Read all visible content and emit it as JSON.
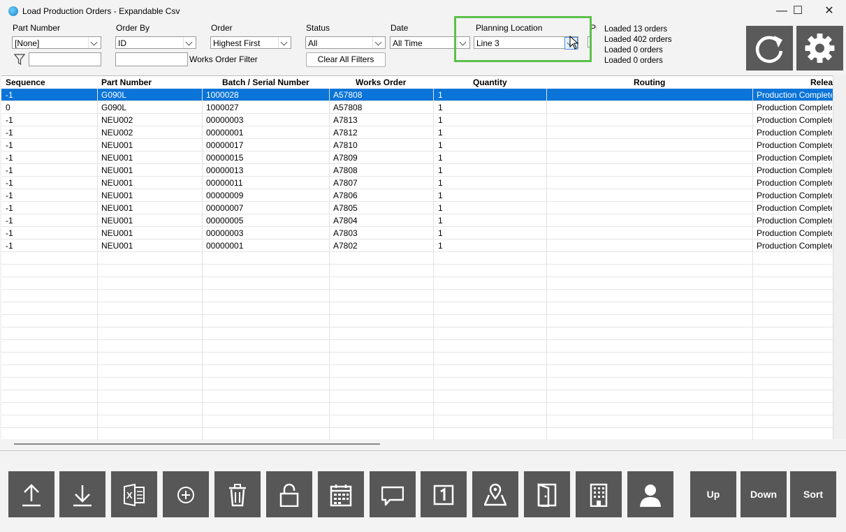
{
  "window": {
    "title": "Load Production Orders - Expandable Csv",
    "minimize": "—",
    "maximize": "☐",
    "close": "✕"
  },
  "filters": {
    "part_number": {
      "label": "Part Number",
      "value": "[None]"
    },
    "order_by": {
      "label": "Order By",
      "value": "ID"
    },
    "order": {
      "label": "Order",
      "value": "Highest First"
    },
    "status": {
      "label": "Status",
      "value": "All"
    },
    "date": {
      "label": "Date",
      "value": "All Time"
    },
    "planning_location": {
      "label": "Planning Location",
      "value": "Line 3"
    },
    "clipped_label": "Pr",
    "works_order_filter_label": "Works Order Filter",
    "clear_all_filters": "Clear All Filters"
  },
  "status_lines": [
    "Loaded 13 orders",
    "Loaded 402 orders",
    "Loaded 0 orders",
    "Loaded 0 orders"
  ],
  "grid": {
    "columns": [
      "Sequence",
      "Part Number",
      "Batch / Serial Number",
      "Works Order",
      "Quantity",
      "Routing",
      "Releas"
    ],
    "rows": [
      [
        "-1",
        "G090L",
        "1000028",
        "A57808",
        "1",
        "",
        "Production Complete"
      ],
      [
        "0",
        "G090L",
        "1000027",
        "A57808",
        "1",
        "",
        "Production Complete"
      ],
      [
        "-1",
        "NEU002",
        "00000003",
        "A7813",
        "1",
        "",
        "Production Complete"
      ],
      [
        "-1",
        "NEU002",
        "00000001",
        "A7812",
        "1",
        "",
        "Production Complete"
      ],
      [
        "-1",
        "NEU001",
        "00000017",
        "A7810",
        "1",
        "",
        "Production Complete"
      ],
      [
        "-1",
        "NEU001",
        "00000015",
        "A7809",
        "1",
        "",
        "Production Complete"
      ],
      [
        "-1",
        "NEU001",
        "00000013",
        "A7808",
        "1",
        "",
        "Production Complete"
      ],
      [
        "-1",
        "NEU001",
        "00000011",
        "A7807",
        "1",
        "",
        "Production Complete"
      ],
      [
        "-1",
        "NEU001",
        "00000009",
        "A7806",
        "1",
        "",
        "Production Complete"
      ],
      [
        "-1",
        "NEU001",
        "00000007",
        "A7805",
        "1",
        "",
        "Production Complete"
      ],
      [
        "-1",
        "NEU001",
        "00000005",
        "A7804",
        "1",
        "",
        "Production Complete"
      ],
      [
        "-1",
        "NEU001",
        "00000003",
        "A7803",
        "1",
        "",
        "Production Complete"
      ],
      [
        "-1",
        "NEU001",
        "00000001",
        "A7802",
        "1",
        "",
        "Production Complete"
      ]
    ],
    "selected_row": 0
  },
  "toolbar": {
    "icons": [
      "upload-icon",
      "download-icon",
      "excel-icon",
      "add-icon",
      "delete-icon",
      "unlock-icon",
      "calendar-icon",
      "comment-icon",
      "number-one-icon",
      "map-location-icon",
      "door-icon",
      "building-icon",
      "user-icon"
    ],
    "up_label": "Up",
    "down_label": "Down",
    "sort_label": "Sort"
  },
  "colors": {
    "selection": "#0a74d8",
    "highlight_box": "#5cc04a",
    "button_bg": "#575757"
  }
}
